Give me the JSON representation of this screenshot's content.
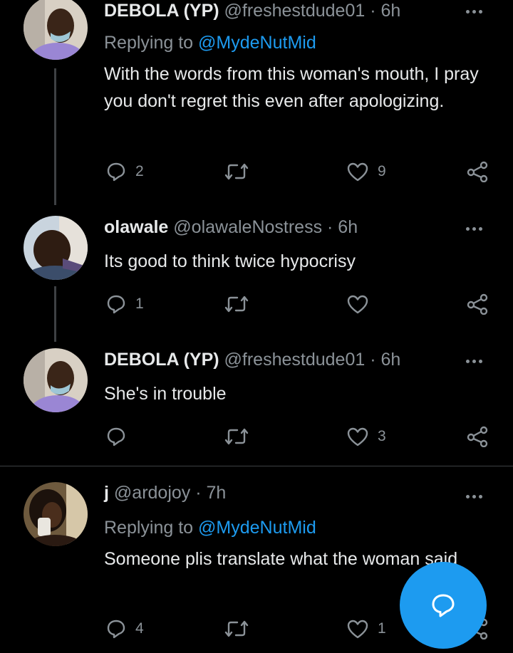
{
  "tweets": [
    {
      "name": "DEBOLA (YP)",
      "meta": "@freshestdude01 · 6h",
      "replying_prefix": "Replying to ",
      "replying_handle": "@MydeNutMid",
      "text": "With the words from this woman's mouth, I pray you don't regret this even after apologizing.",
      "replies": "2",
      "likes": "9"
    },
    {
      "name": "olawale",
      "meta": "@olawaleNostress · 6h",
      "text": "Its good to think twice hypocrisy",
      "replies": "1",
      "likes": ""
    },
    {
      "name": "DEBOLA (YP)",
      "meta": "@freshestdude01 · 6h",
      "text": "She's in trouble",
      "replies": "",
      "likes": "3"
    },
    {
      "name": "j",
      "meta": "@ardojoy · 7h",
      "replying_prefix": "Replying to ",
      "replying_handle": "@MydeNutMid",
      "text": "Someone plis translate what the woman said",
      "replies": "4",
      "likes": "1"
    }
  ],
  "icons": {
    "reply": "reply-icon",
    "retweet": "retweet-icon",
    "like": "heart-icon",
    "share": "share-icon",
    "compose": "compose-reply-icon"
  },
  "colors": {
    "accent": "#1d9bf0",
    "background": "#000000",
    "muted": "#8b9298"
  }
}
